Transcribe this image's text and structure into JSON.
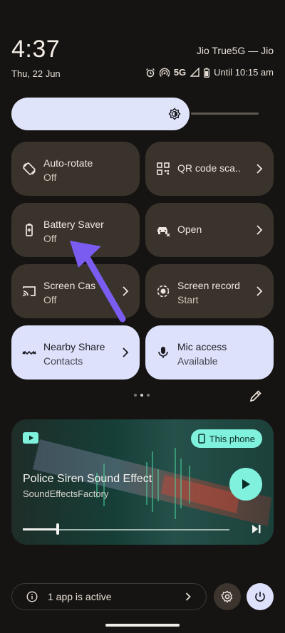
{
  "status": {
    "time": "4:37",
    "carrier": "Jio True5G — Jio",
    "date": "Thu, 22 Jun",
    "network": "5G",
    "battery_text": "Until 10:15 am"
  },
  "tiles": [
    {
      "name": "auto-rotate",
      "title": "Auto-rotate",
      "subtitle": "Off"
    },
    {
      "name": "qr-code-scanner",
      "title": "QR code sca..",
      "subtitle": ""
    },
    {
      "name": "battery-saver",
      "title": "Battery Saver",
      "subtitle": "Off"
    },
    {
      "name": "open",
      "title": "Open",
      "subtitle": ""
    },
    {
      "name": "screen-cast",
      "title": "Screen Cas",
      "subtitle": "Off"
    },
    {
      "name": "screen-record",
      "title": "Screen record",
      "subtitle": "Start"
    },
    {
      "name": "nearby-share",
      "title": "Nearby Share",
      "subtitle": "Contacts"
    },
    {
      "name": "mic-access",
      "title": "Mic access",
      "subtitle": "Available"
    }
  ],
  "media": {
    "output_chip": "This phone",
    "title": "Police Siren Sound Effect",
    "artist": "SoundEffectsFactory",
    "progress": 0.17
  },
  "footer": {
    "active_apps": "1 app is active"
  },
  "icons": {
    "brightness": "brightness-icon",
    "auto_rotate": "rotate-icon",
    "qr": "qr-code-icon",
    "battery": "battery-icon",
    "open": "car-icon",
    "cast": "cast-icon",
    "record": "record-icon",
    "nearby": "nearby-share-icon",
    "mic": "mic-icon",
    "edit": "pencil-icon",
    "youtube": "youtube-icon",
    "play": "play-icon",
    "skip": "skip-next-icon",
    "info": "info-icon",
    "settings": "gear-icon",
    "power": "power-icon"
  },
  "colors": {
    "background": "#161412",
    "tile_dark": "#3a332c",
    "tile_light": "#dde1fb",
    "accent_teal": "#7ff1dd",
    "annotation_arrow": "#7b5cf0"
  }
}
